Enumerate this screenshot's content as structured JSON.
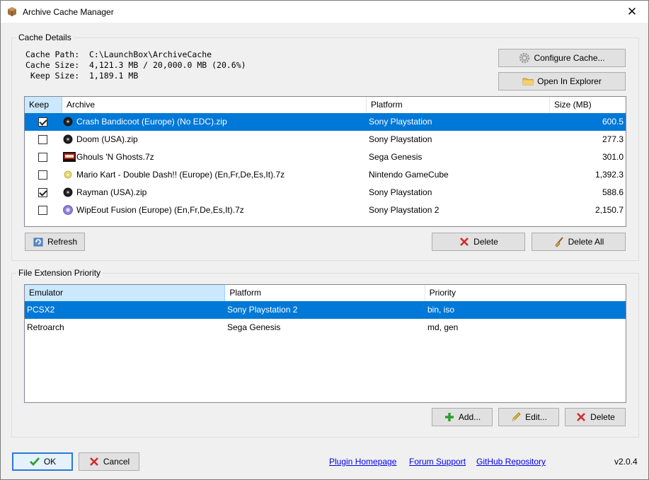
{
  "window": {
    "title": "Archive Cache Manager",
    "close_glyph": "✕"
  },
  "cache_details": {
    "group_title": "Cache Details",
    "path_line": "Cache Path:  C:\\LaunchBox\\ArchiveCache",
    "size_line": "Cache Size:  4,121.3 MB / 20,000.0 MB (20.6%)",
    "keep_line": " Keep Size:  1,189.1 MB",
    "configure_label": "Configure Cache...",
    "explorer_label": "Open In Explorer",
    "columns": [
      "Keep",
      "Archive",
      "Platform",
      "Size (MB)"
    ],
    "rows": [
      {
        "keep": true,
        "archive": "Crash Bandicoot (Europe) (No EDC).zip",
        "platform": "Sony Playstation",
        "size": "600.5",
        "icon": "ps1-disc-icon",
        "selected": true
      },
      {
        "keep": false,
        "archive": "Doom (USA).zip",
        "platform": "Sony Playstation",
        "size": "277.3",
        "icon": "ps1-disc-icon",
        "selected": false
      },
      {
        "keep": false,
        "archive": "Ghouls 'N Ghosts.7z",
        "platform": "Sega Genesis",
        "size": "301.0",
        "icon": "genesis-cart-icon",
        "selected": false
      },
      {
        "keep": false,
        "archive": "Mario Kart - Double Dash!! (Europe) (En,Fr,De,Es,It).7z",
        "platform": "Nintendo GameCube",
        "size": "1,392.3",
        "icon": "gamecube-disc-icon",
        "selected": false
      },
      {
        "keep": true,
        "archive": "Rayman (USA).zip",
        "platform": "Sony Playstation",
        "size": "588.6",
        "icon": "ps1-disc-icon",
        "selected": false
      },
      {
        "keep": false,
        "archive": "WipEout Fusion (Europe) (En,Fr,De,Es,It).7z",
        "platform": "Sony Playstation 2",
        "size": "2,150.7",
        "icon": "ps2-disc-icon",
        "selected": false
      }
    ],
    "refresh_label": "Refresh",
    "delete_label": "Delete",
    "delete_all_label": "Delete All"
  },
  "priority": {
    "group_title": "File Extension Priority",
    "columns": [
      "Emulator",
      "Platform",
      "Priority"
    ],
    "rows": [
      {
        "emulator": "PCSX2",
        "platform": "Sony Playstation 2",
        "priority": "bin, iso",
        "selected": true
      },
      {
        "emulator": "Retroarch",
        "platform": "Sega Genesis",
        "priority": "md, gen",
        "selected": false
      }
    ],
    "add_label": "Add...",
    "edit_label": "Edit...",
    "delete_label": "Delete"
  },
  "footer": {
    "ok_label": "OK",
    "cancel_label": "Cancel",
    "links": [
      "Plugin Homepage",
      "Forum Support",
      "GitHub Repository"
    ],
    "version": "v2.0.4"
  },
  "colors": {
    "accent": "#0078d7",
    "link": "#0000ee",
    "delete_red": "#d42a2a",
    "add_green": "#2e9e2e"
  }
}
